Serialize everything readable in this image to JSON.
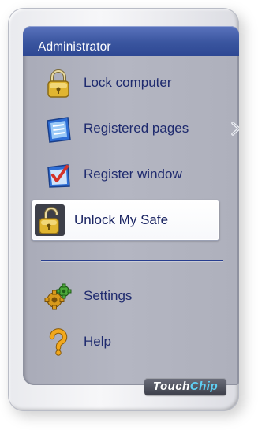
{
  "header": {
    "title": "Administrator"
  },
  "menu": {
    "items": [
      {
        "label": "Lock computer",
        "icon": "padlock-icon"
      },
      {
        "label": "Registered pages",
        "icon": "notepad-icon",
        "has_submenu": true
      },
      {
        "label": "Register window",
        "icon": "window-check-icon"
      },
      {
        "label": "Unlock My Safe",
        "icon": "open-padlock-icon",
        "selected": true
      }
    ],
    "bottom_items": [
      {
        "label": "Settings",
        "icon": "gears-icon"
      },
      {
        "label": "Help",
        "icon": "question-mark-icon"
      }
    ]
  },
  "brand": {
    "logo_text_1": "Touch",
    "logo_text_2": "Chip"
  },
  "colors": {
    "header": "#3a559f",
    "label": "#1e2a6e",
    "divider": "#283e8f",
    "logo_accent": "#5fd0f5"
  }
}
